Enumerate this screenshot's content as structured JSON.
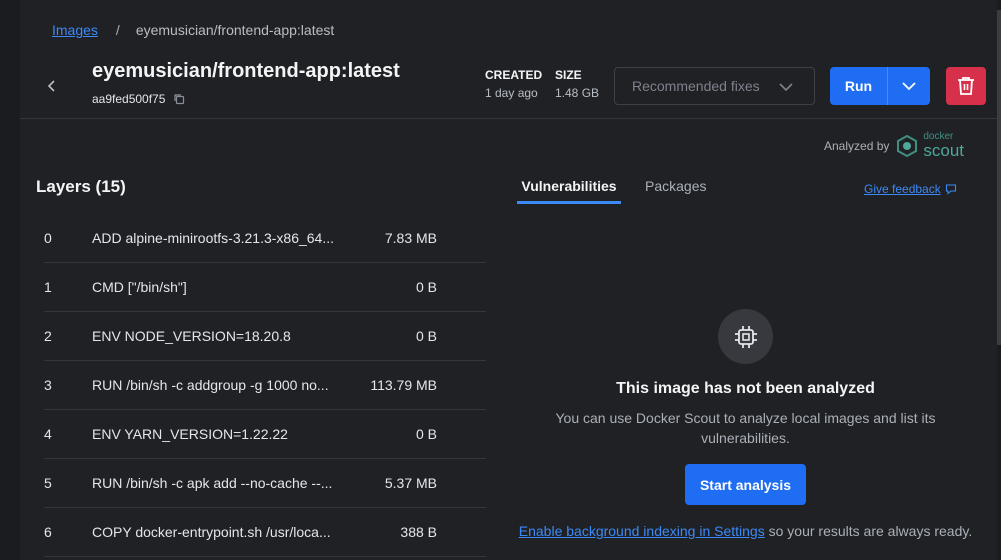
{
  "breadcrumb": {
    "link_label": "Images",
    "separator": "/",
    "current": "eyemusician/frontend-app:latest"
  },
  "header": {
    "title": "eyemusician/frontend-app:latest",
    "image_id": "aa9fed500f75",
    "created_label": "CREATED",
    "created_value": "1 day ago",
    "size_label": "SIZE",
    "size_value": "1.48 GB",
    "recommended_fixes_label": "Recommended fixes",
    "run_label": "Run"
  },
  "analyzed": {
    "label": "Analyzed by",
    "brand_small": "docker",
    "brand_large": "scout"
  },
  "layers": {
    "title": "Layers (15)",
    "rows": [
      {
        "index": "0",
        "command": "ADD alpine-minirootfs-3.21.3-x86_64...",
        "size": "7.83 MB"
      },
      {
        "index": "1",
        "command": "CMD [\"/bin/sh\"]",
        "size": "0 B"
      },
      {
        "index": "2",
        "command": "ENV NODE_VERSION=18.20.8",
        "size": "0 B"
      },
      {
        "index": "3",
        "command": "RUN /bin/sh -c addgroup -g 1000 no...",
        "size": "113.79 MB"
      },
      {
        "index": "4",
        "command": "ENV YARN_VERSION=1.22.22",
        "size": "0 B"
      },
      {
        "index": "5",
        "command": "RUN /bin/sh -c apk add --no-cache --...",
        "size": "5.37 MB"
      },
      {
        "index": "6",
        "command": "COPY docker-entrypoint.sh /usr/loca...",
        "size": "388 B"
      }
    ]
  },
  "tabs": {
    "vulnerabilities": "Vulnerabilities",
    "packages": "Packages",
    "feedback": "Give feedback"
  },
  "empty_state": {
    "title": "This image has not been analyzed",
    "description": "You can use Docker Scout to analyze local images and list its vulnerabilities.",
    "button": "Start analysis",
    "indexing_link": "Enable background indexing in Settings",
    "indexing_rest": " so your results are always ready."
  },
  "colors": {
    "accent": "#1f6df2",
    "link": "#3c8af7",
    "danger": "#d6304a",
    "scout": "#4fa79a",
    "background": "#202124"
  }
}
